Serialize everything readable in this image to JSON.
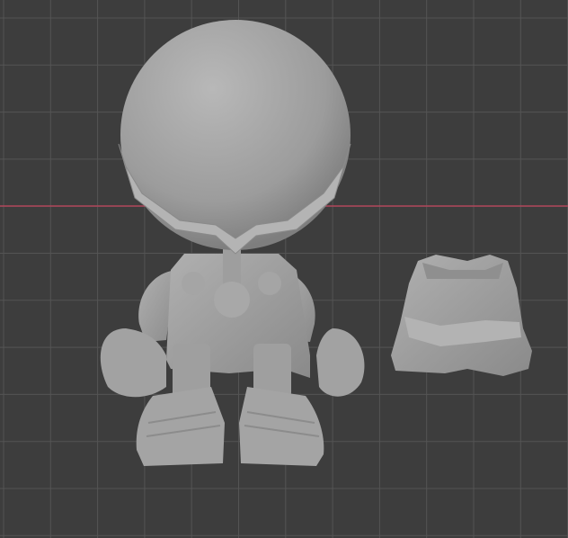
{
  "viewport": {
    "background_color": "#3d3d3d",
    "grid_color": "#545454",
    "x_axis_color": "#b0465a",
    "model_color": "#a9a9a9"
  },
  "objects": [
    "character-figure",
    "torso-armor-piece"
  ]
}
